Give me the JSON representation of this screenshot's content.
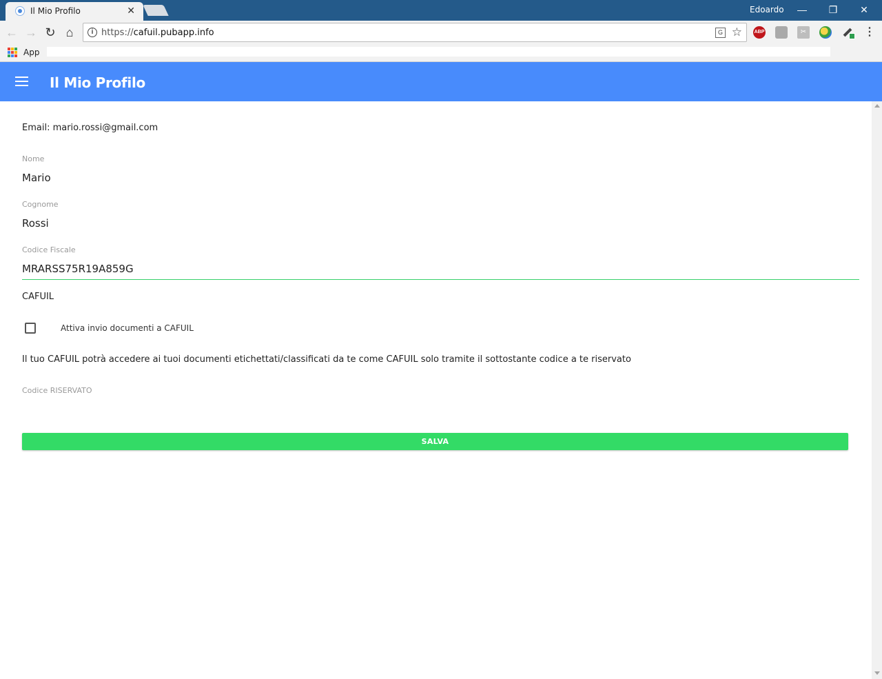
{
  "browser": {
    "tab_title": "Il Mio Profilo",
    "tab_close": "✕",
    "profile_name": "Edoardo",
    "url_scheme": "https://",
    "url_host": "cafuil.pubapp.info",
    "bookmarks_apps_label": "App",
    "ext_abp_label": "ABP",
    "apps_icon_colors": [
      "#e94235",
      "#fbbc04",
      "#34a853",
      "#4285f4",
      "#e94235",
      "#fbbc04",
      "#34a853",
      "#4285f4",
      "#e94235"
    ]
  },
  "app": {
    "header_color": "#488bfc",
    "title": "Il Mio Profilo"
  },
  "profile": {
    "email_line": "Email: mario.rossi@gmail.com",
    "nome_label": "Nome",
    "nome_value": "Mario",
    "cognome_label": "Cognome",
    "cognome_value": "Rossi",
    "cf_label": "Codice Fiscale",
    "cf_value": "MRARSS75R19A859G",
    "section_cafuil": "CAFUIL",
    "checkbox_label": "Attiva invio documenti a CAFUIL",
    "checkbox_checked": false,
    "info_text": "Il tuo CAFUIL potrà accedere ai tuoi documenti etichettati/classificati da te come CAFUIL solo tramite il sottostante codice a te riservato",
    "codice_label": "Codice RISERVATO",
    "codice_value": "",
    "save_label": "SALVA",
    "save_color": "#33db66"
  }
}
